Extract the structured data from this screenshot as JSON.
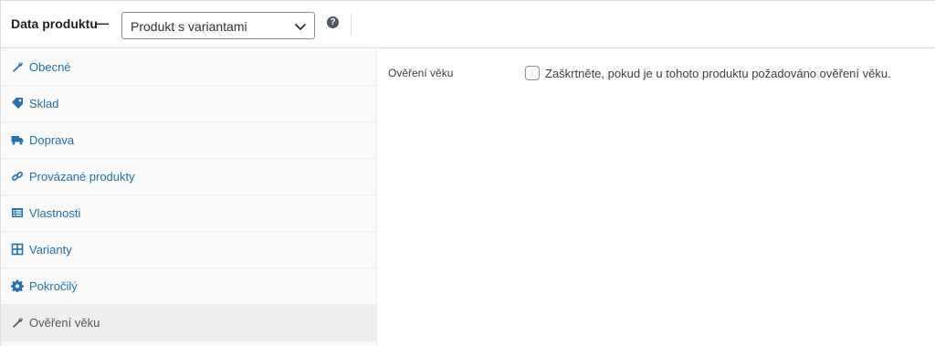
{
  "header": {
    "title": "Data produktu",
    "dash": "—",
    "product_type": {
      "selected": "Produkt s variantami"
    },
    "help_icon": "question-circle-icon"
  },
  "tabs": [
    {
      "label": "Obecné",
      "icon": "wrench-icon",
      "active": false
    },
    {
      "label": "Sklad",
      "icon": "tag-icon",
      "active": false
    },
    {
      "label": "Doprava",
      "icon": "truck-icon",
      "active": false
    },
    {
      "label": "Provázané produkty",
      "icon": "link-icon",
      "active": false
    },
    {
      "label": "Vlastnosti",
      "icon": "list-table-icon",
      "active": false
    },
    {
      "label": "Varianty",
      "icon": "grid-icon",
      "active": false
    },
    {
      "label": "Pokročilý",
      "icon": "gear-icon",
      "active": false
    },
    {
      "label": "Ověření věku",
      "icon": "wrench-icon",
      "active": true
    }
  ],
  "content": {
    "field_label": "Ověření věku",
    "checkbox_checked": false,
    "checkbox_description": "Zaškrtněte, pokud je u tohoto produktu požadováno ověření věku."
  },
  "colors": {
    "link": "#2271b1",
    "active_tab_bg": "#eeeeee",
    "border": "#dcdcde"
  }
}
